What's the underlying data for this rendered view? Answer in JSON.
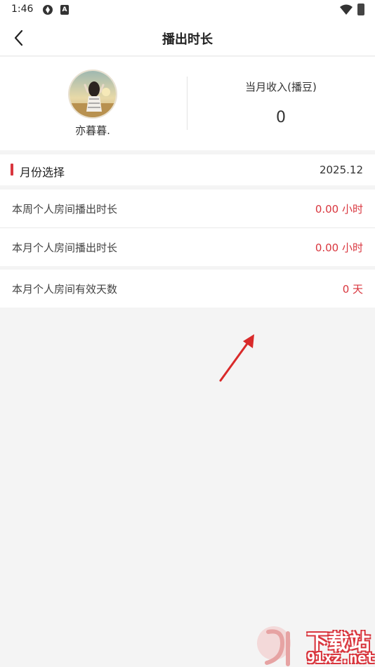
{
  "status_bar": {
    "time": "1:46",
    "icons": [
      "sync-icon",
      "a-badge-icon",
      "wifi-icon",
      "battery-charging-icon"
    ],
    "a_badge": "A"
  },
  "header": {
    "title": "播出时长",
    "back_icon": "chevron-left-icon"
  },
  "profile": {
    "username": "亦暮暮.",
    "income_label": "当月收入(播豆)",
    "income_value": "0"
  },
  "month_selector": {
    "label": "月份选择",
    "value": "2025.12"
  },
  "stats": [
    {
      "label": "本周个人房间播出时长",
      "value": "0.00 小时"
    },
    {
      "label": "本月个人房间播出时长",
      "value": "0.00 小时"
    },
    {
      "label": "本月个人房间有效天数",
      "value": "0 天"
    }
  ],
  "watermark": {
    "line1": "下载站",
    "line2": "91xz.net"
  },
  "colors": {
    "accent": "#d9363e",
    "background": "#f4f4f4",
    "card": "#ffffff"
  }
}
